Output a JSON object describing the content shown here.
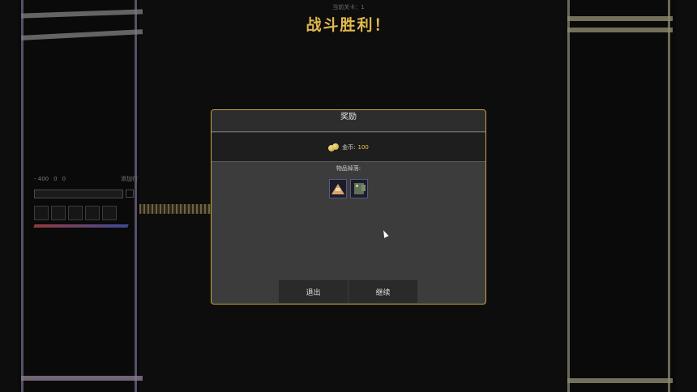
{
  "stage_name": "当前关卡：1",
  "victory_title": "战斗胜利！",
  "hud": {
    "stat1": "- 400",
    "stat2": "0",
    "stat3": "0",
    "add_label": "添加行"
  },
  "dialog": {
    "title": "奖励",
    "gold_label": "金币:",
    "gold_amount": "100",
    "drops_label": "物品掉落:",
    "drops": [
      {
        "icon": "sand-pile-icon"
      },
      {
        "icon": "machine-icon"
      }
    ],
    "buttons": {
      "exit": "退出",
      "continue": "继续"
    }
  },
  "colors": {
    "accent_gold": "#e0b84c",
    "dialog_border": "#c8a440"
  }
}
